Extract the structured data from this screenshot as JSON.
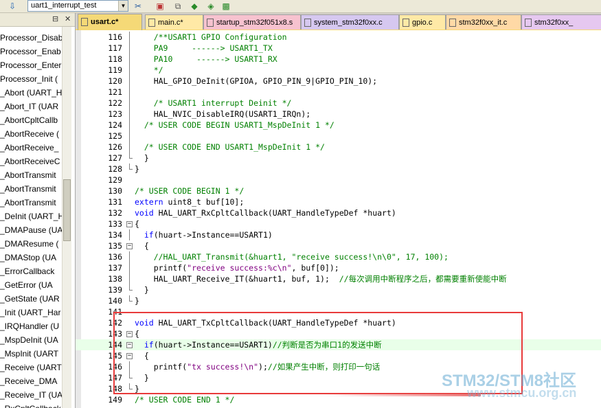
{
  "toolbar": {
    "target_value": "uart1_interrupt_test",
    "icons": [
      "options-icon",
      "manage-icon",
      "copy-icon",
      "pack-icon",
      "diamond-icon",
      "browse-icon"
    ]
  },
  "left_panel": {
    "items": [
      "Processor_Disab",
      "Processor_Enab",
      "Processor_Enter",
      "Processor_Init (",
      "_Abort (UART_H",
      "_Abort_IT (UAR",
      "_AbortCpltCallb",
      "_AbortReceive (",
      "_AbortReceive_",
      "_AbortReceiveC",
      "_AbortTransmit",
      "_AbortTransmit",
      "_AbortTransmit",
      "_DeInit (UART_H",
      "_DMAPause (UA",
      "_DMAResume (",
      "_DMAStop (UA",
      "_ErrorCallback",
      "_GetError (UA",
      "_GetState (UAR",
      "_Init (UART_Har",
      "_IRQHandler (U",
      "_MspDeInit (UA",
      "_MspInit (UART",
      "_Receive (UART",
      "_Receive_DMA",
      "_Receive_IT (UA",
      "_RxCpltCallback"
    ]
  },
  "tabs": [
    {
      "label": "usart.c*",
      "color": "#f5d977",
      "active": true
    },
    {
      "label": "main.c*",
      "color": "#ffe9a6",
      "active": false
    },
    {
      "label": "startup_stm32f051x8.s",
      "color": "#f7c2cf",
      "active": false
    },
    {
      "label": "system_stm32f0xx.c",
      "color": "#d6c8f0",
      "active": false
    },
    {
      "label": "gpio.c",
      "color": "#ffe9a6",
      "active": false
    },
    {
      "label": "stm32f0xx_it.c",
      "color": "#ffd9a6",
      "active": false
    },
    {
      "label": "stm32f0xx_",
      "color": "#e6c8f0",
      "active": false
    }
  ],
  "code_lines": [
    {
      "n": "116",
      "fold": "line",
      "segs": [
        [
          "c-comment",
          "    /**USART1 GPIO Configuration"
        ]
      ]
    },
    {
      "n": "117",
      "fold": "line",
      "segs": [
        [
          "c-comment",
          "    PA9     ------> USART1_TX"
        ]
      ]
    },
    {
      "n": "118",
      "fold": "line",
      "segs": [
        [
          "c-comment",
          "    PA10     ------> USART1_RX"
        ]
      ]
    },
    {
      "n": "119",
      "fold": "line",
      "segs": [
        [
          "c-comment",
          "    */"
        ]
      ]
    },
    {
      "n": "120",
      "fold": "line",
      "segs": [
        [
          "c-norm",
          "    HAL_GPIO_DeInit(GPIOA, GPIO_PIN_9|GPIO_PIN_10);"
        ]
      ]
    },
    {
      "n": "121",
      "fold": "line",
      "segs": [
        [
          "c-norm",
          ""
        ]
      ]
    },
    {
      "n": "122",
      "fold": "line",
      "segs": [
        [
          "c-comment",
          "    /* USART1 interrupt Deinit */"
        ]
      ]
    },
    {
      "n": "123",
      "fold": "line",
      "segs": [
        [
          "c-norm",
          "    HAL_NVIC_DisableIRQ(USART1_IRQn);"
        ]
      ]
    },
    {
      "n": "124",
      "fold": "line",
      "segs": [
        [
          "c-comment",
          "  /* USER CODE BEGIN USART1_MspDeInit 1 */"
        ]
      ]
    },
    {
      "n": "125",
      "fold": "line",
      "segs": [
        [
          "c-norm",
          ""
        ]
      ]
    },
    {
      "n": "126",
      "fold": "line",
      "segs": [
        [
          "c-comment",
          "  /* USER CODE END USART1_MspDeInit 1 */"
        ]
      ]
    },
    {
      "n": "127",
      "fold": "end",
      "segs": [
        [
          "c-norm",
          "  }"
        ]
      ]
    },
    {
      "n": "128",
      "fold": "end",
      "segs": [
        [
          "c-norm",
          "}"
        ]
      ]
    },
    {
      "n": "129",
      "fold": "none",
      "segs": [
        [
          "c-norm",
          ""
        ]
      ]
    },
    {
      "n": "130",
      "fold": "none",
      "segs": [
        [
          "c-comment",
          "/* USER CODE BEGIN 1 */"
        ]
      ]
    },
    {
      "n": "131",
      "fold": "none",
      "segs": [
        [
          "c-kw",
          "extern"
        ],
        [
          "c-norm",
          " uint8_t buf[10];"
        ]
      ]
    },
    {
      "n": "132",
      "fold": "none",
      "segs": [
        [
          "c-kw",
          "void"
        ],
        [
          "c-norm",
          " HAL_UART_RxCpltCallback(UART_HandleTypeDef *huart)"
        ]
      ]
    },
    {
      "n": "133",
      "fold": "box",
      "segs": [
        [
          "c-norm",
          "{"
        ]
      ]
    },
    {
      "n": "134",
      "fold": "line",
      "segs": [
        [
          "c-norm",
          "  "
        ],
        [
          "c-kw",
          "if"
        ],
        [
          "c-norm",
          "(huart->Instance==USART1)"
        ]
      ]
    },
    {
      "n": "135",
      "fold": "box",
      "segs": [
        [
          "c-norm",
          "  {"
        ]
      ]
    },
    {
      "n": "136",
      "fold": "line",
      "segs": [
        [
          "c-comment",
          "    //HAL_UART_Transmit(&huart1, \"receive success!\\n\\0\", 17, 100);"
        ]
      ]
    },
    {
      "n": "137",
      "fold": "line",
      "segs": [
        [
          "c-norm",
          "    printf("
        ],
        [
          "c-str",
          "\"receive success:%c\\n\""
        ],
        [
          "c-norm",
          ", buf[0]);"
        ]
      ]
    },
    {
      "n": "138",
      "fold": "line",
      "segs": [
        [
          "c-norm",
          "    HAL_UART_Receive_IT(&huart1, buf, 1);  "
        ],
        [
          "c-comment",
          "//每次调用中断程序之后，都需要重新使能中断"
        ]
      ]
    },
    {
      "n": "139",
      "fold": "end",
      "segs": [
        [
          "c-norm",
          "  }"
        ]
      ]
    },
    {
      "n": "140",
      "fold": "end",
      "segs": [
        [
          "c-norm",
          "}"
        ]
      ]
    },
    {
      "n": "141",
      "fold": "none",
      "segs": [
        [
          "c-norm",
          ""
        ]
      ]
    },
    {
      "n": "142",
      "fold": "none",
      "segs": [
        [
          "c-kw",
          "void"
        ],
        [
          "c-norm",
          " HAL_UART_TxCpltCallback(UART_HandleTypeDef *huart)"
        ]
      ]
    },
    {
      "n": "143",
      "fold": "box",
      "segs": [
        [
          "c-norm",
          "{"
        ]
      ]
    },
    {
      "n": "144",
      "fold": "box",
      "current": true,
      "segs": [
        [
          "c-norm",
          "  "
        ],
        [
          "c-kw",
          "if"
        ],
        [
          "c-norm",
          "(huart->Instance==USART1)"
        ],
        [
          "c-comment",
          "//判断是否为串口1的发送中断"
        ]
      ]
    },
    {
      "n": "145",
      "fold": "box",
      "segs": [
        [
          "c-norm",
          "  {"
        ]
      ]
    },
    {
      "n": "146",
      "fold": "line",
      "segs": [
        [
          "c-norm",
          "    printf("
        ],
        [
          "c-str",
          "\"tx success!\\n\""
        ],
        [
          "c-norm",
          ");"
        ],
        [
          "c-comment",
          "//如果产生中断，则打印一句话"
        ]
      ]
    },
    {
      "n": "147",
      "fold": "end",
      "segs": [
        [
          "c-norm",
          "  }"
        ]
      ]
    },
    {
      "n": "148",
      "fold": "end",
      "segs": [
        [
          "c-norm",
          "}"
        ]
      ]
    },
    {
      "n": "149",
      "fold": "none",
      "segs": [
        [
          "c-comment",
          "/* USER CODE END 1 */"
        ]
      ]
    }
  ],
  "watermark": {
    "title": "STM32/STM8社区",
    "url": "www.stmcu.org.cn"
  },
  "colors": {
    "highlight_box": "#e83a3a",
    "active_tab": "#f5d977",
    "comment": "#008000",
    "keyword": "#0000ff",
    "string": "#800080"
  }
}
